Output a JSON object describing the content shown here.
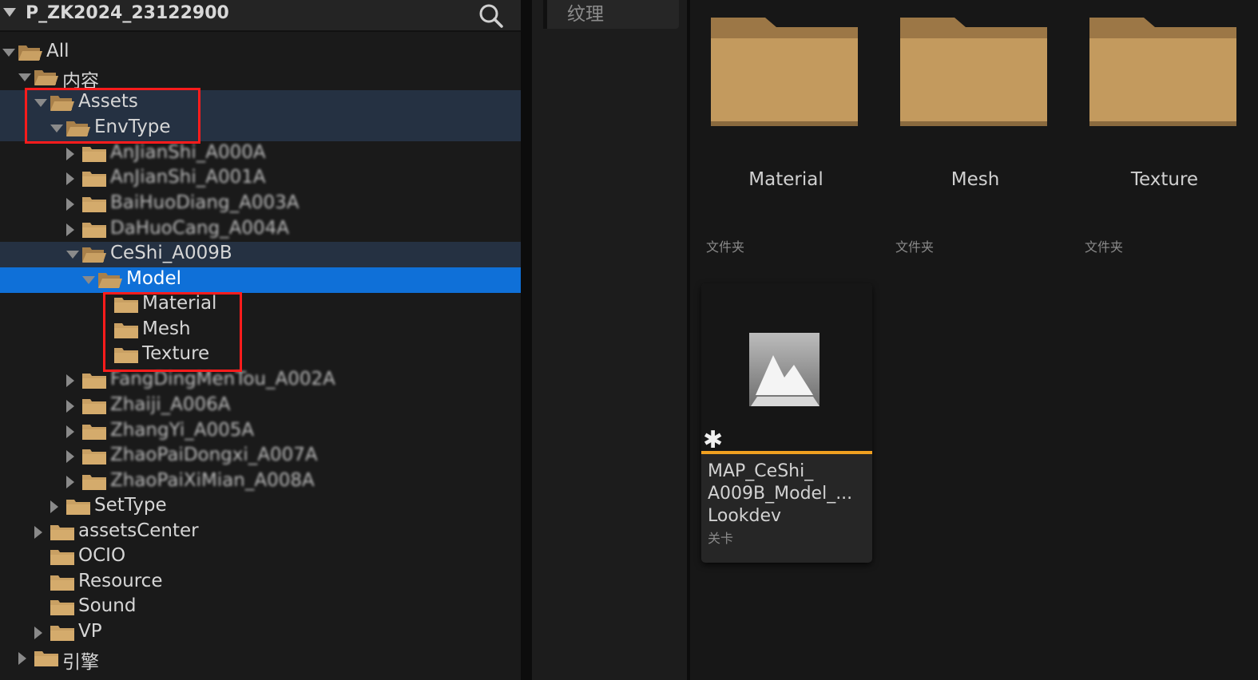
{
  "tree": {
    "project_title": "P_ZK2024_23122900",
    "search_icon": "search-icon",
    "items": [
      {
        "label": "All"
      },
      {
        "label": "内容"
      },
      {
        "label": "Assets"
      },
      {
        "label": "EnvType"
      },
      {
        "label": "AnJianShi_A000A"
      },
      {
        "label": "AnJianShi_A001A"
      },
      {
        "label": "BaiHuoDiang_A003A"
      },
      {
        "label": "DaHuoCang_A004A"
      },
      {
        "label": "CeShi_A009B"
      },
      {
        "label": "Model"
      },
      {
        "label": "Material"
      },
      {
        "label": "Mesh"
      },
      {
        "label": "Texture"
      },
      {
        "label": "FangDingMenTou_A002A"
      },
      {
        "label": "Zhaiji_A006A"
      },
      {
        "label": "ZhangYi_A005A"
      },
      {
        "label": "ZhaoPaiDongxi_A007A"
      },
      {
        "label": "ZhaoPaiXiMian_A008A"
      },
      {
        "label": "SetType"
      },
      {
        "label": "assetsCenter"
      },
      {
        "label": "OCIO"
      },
      {
        "label": "Resource"
      },
      {
        "label": "Sound"
      },
      {
        "label": "VP"
      },
      {
        "label": "引擎"
      }
    ]
  },
  "filter": {
    "label": "纹理"
  },
  "content": {
    "folders": [
      {
        "name": "Material",
        "type": "文件夹"
      },
      {
        "name": "Mesh",
        "type": "文件夹"
      },
      {
        "name": "Texture",
        "type": "文件夹"
      }
    ],
    "asset": {
      "name": "MAP_CeShi_ A009B_Model_... Lookdev",
      "name_lines": [
        "MAP_CeShi_",
        "A009B_Model_...",
        "Lookdev"
      ],
      "type": "关卡",
      "accent": "#f0a020"
    }
  },
  "colors": {
    "selection": "#0f70d8",
    "highlight_row": "#253142",
    "annotation_red": "#ff1c1c",
    "folder": "#c9a063"
  }
}
